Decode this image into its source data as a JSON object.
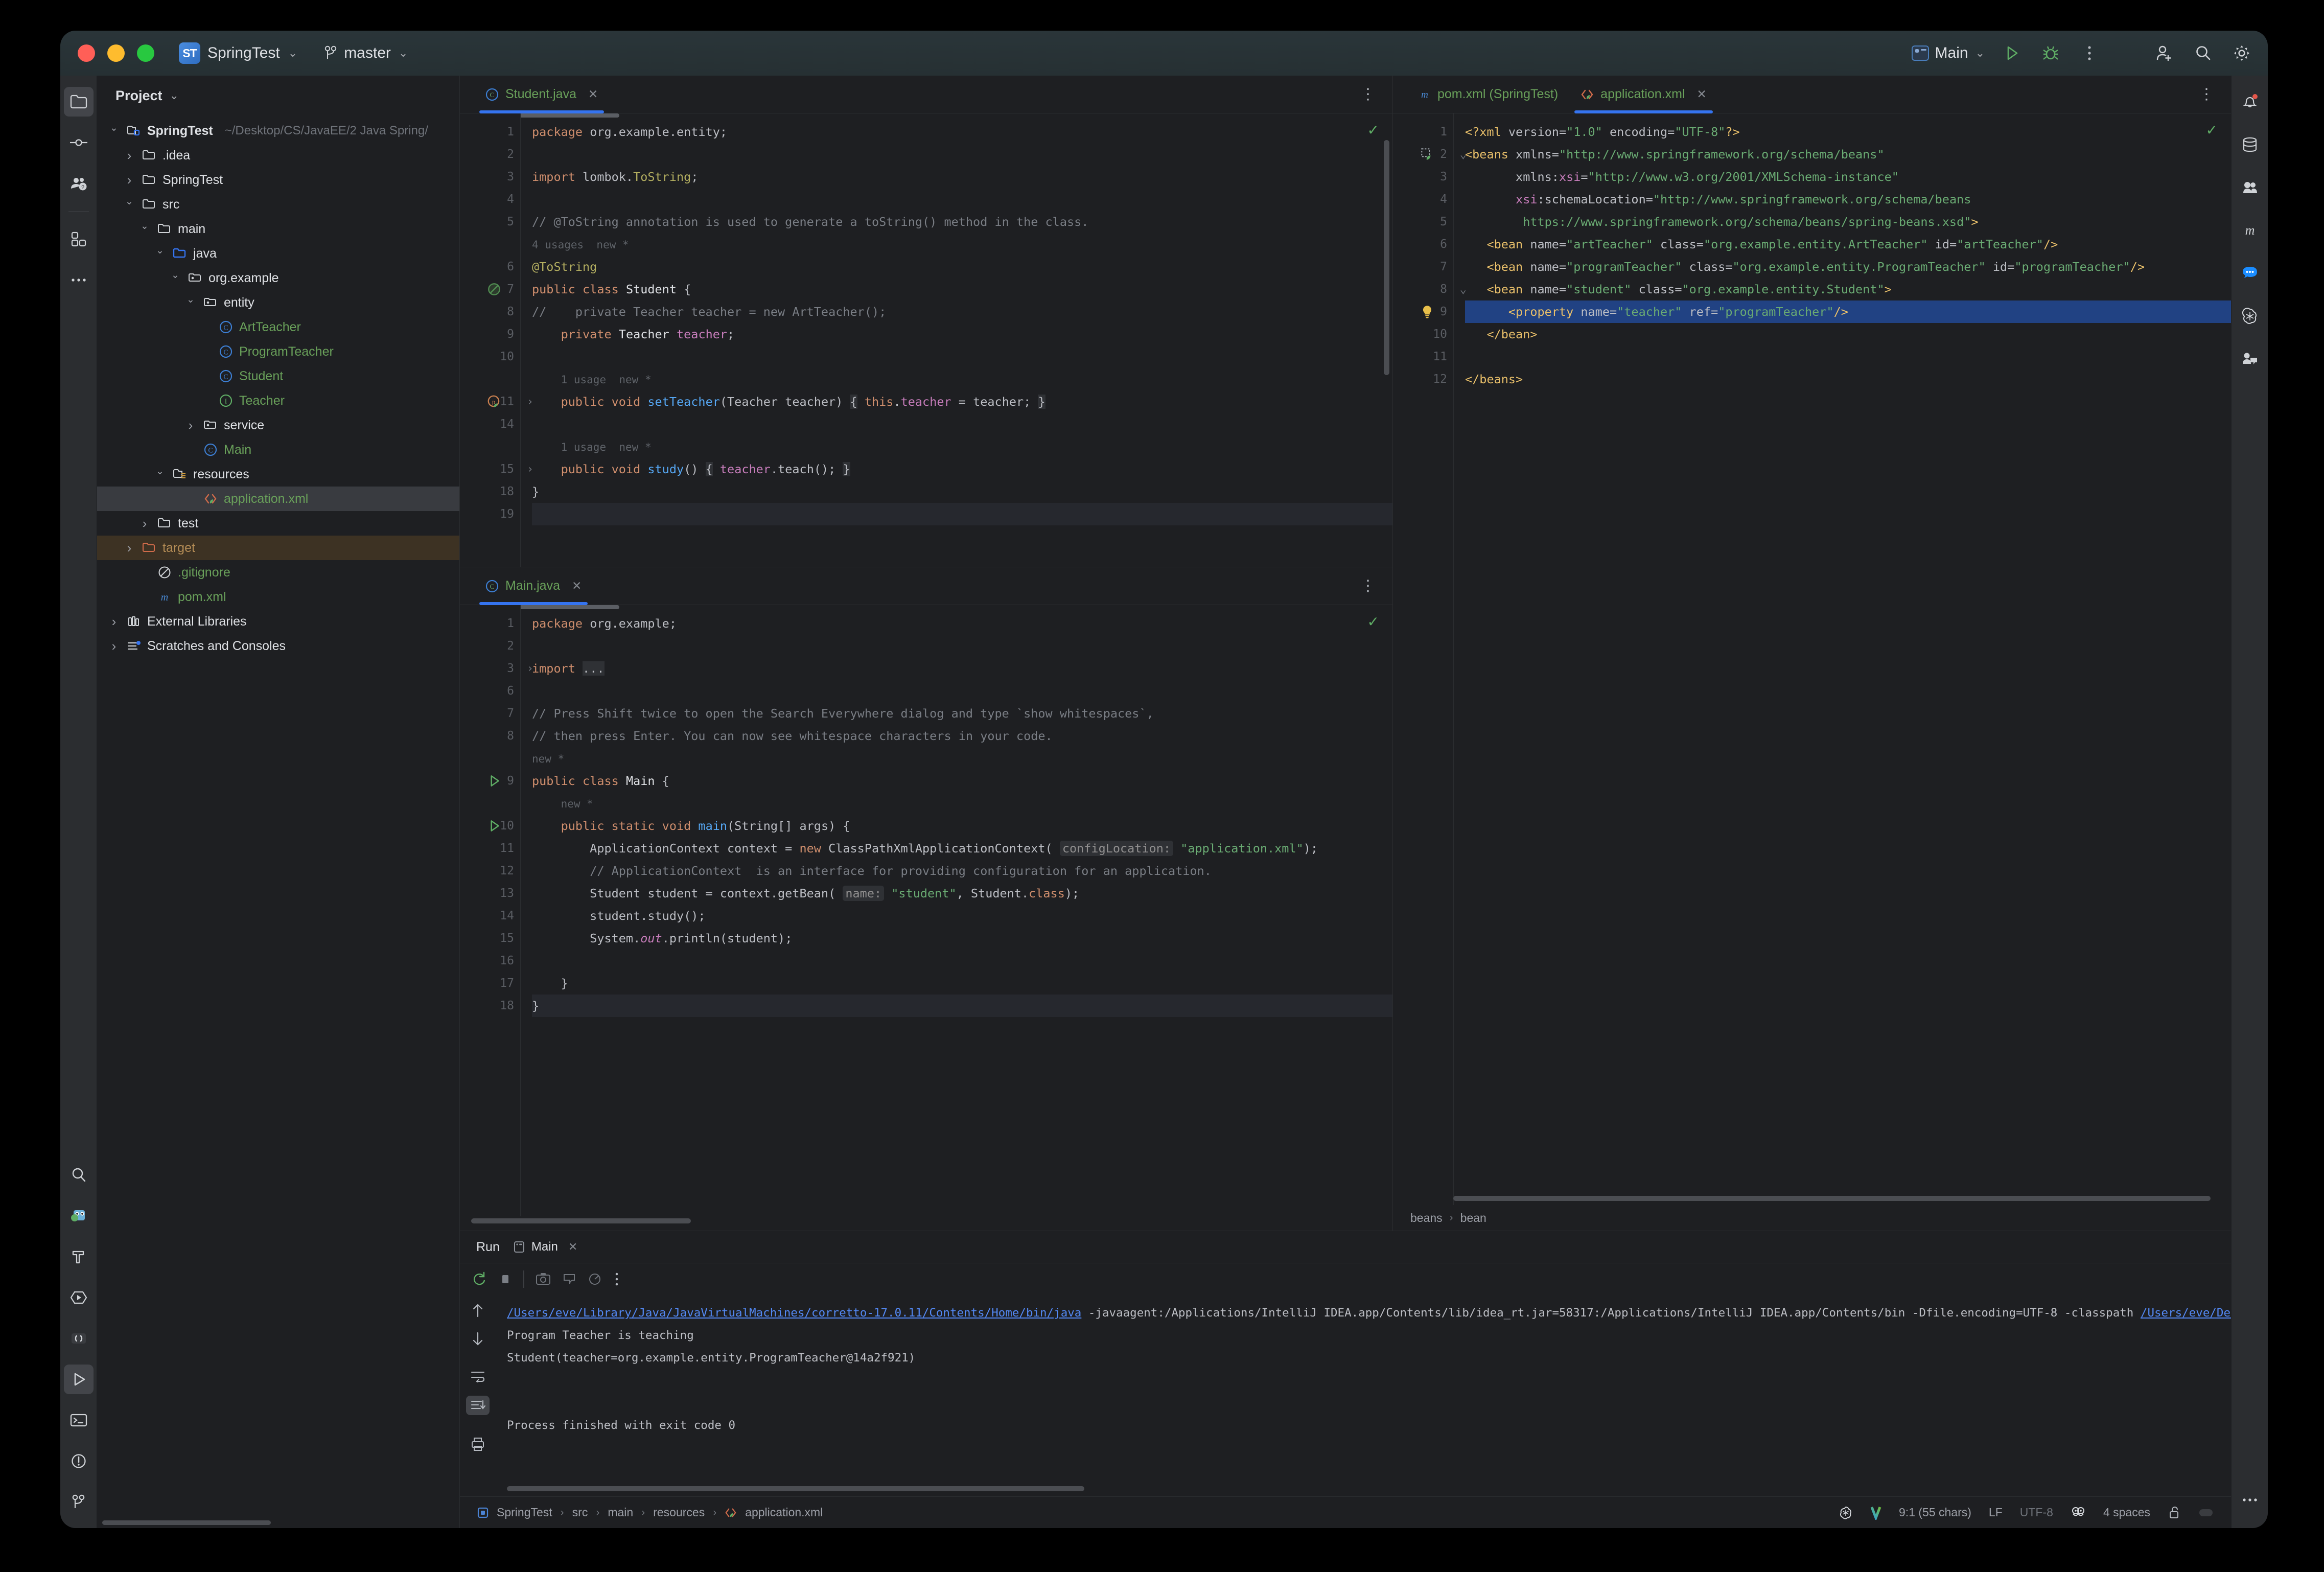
{
  "titlebar": {
    "project_badge": "ST",
    "project_name": "SpringTest",
    "branch": "master",
    "run_config": "Main",
    "icons": [
      "run-icon",
      "debug-icon",
      "more-options-icon",
      "add-user-icon",
      "search-icon",
      "settings-icon"
    ]
  },
  "project_panel": {
    "title": "Project",
    "tree": [
      {
        "label": "SpringTest",
        "path": "~/Desktop/CS/JavaEE/2 Java Spring/",
        "indent": 0,
        "arrow": "down",
        "icon": "module-folder-icon",
        "style": "bold"
      },
      {
        "label": ".idea",
        "indent": 1,
        "arrow": "right",
        "icon": "folder-icon",
        "style": "plain"
      },
      {
        "label": "SpringTest",
        "indent": 1,
        "arrow": "right",
        "icon": "folder-icon",
        "style": "plain"
      },
      {
        "label": "src",
        "indent": 1,
        "arrow": "down",
        "icon": "folder-icon",
        "style": "plain"
      },
      {
        "label": "main",
        "indent": 2,
        "arrow": "down",
        "icon": "folder-icon",
        "style": "plain"
      },
      {
        "label": "java",
        "indent": 3,
        "arrow": "down",
        "icon": "source-root-icon",
        "style": "plain"
      },
      {
        "label": "org.example",
        "indent": 4,
        "arrow": "down",
        "icon": "package-icon",
        "style": "plain"
      },
      {
        "label": "entity",
        "indent": 5,
        "arrow": "down",
        "icon": "package-icon",
        "style": "plain"
      },
      {
        "label": "ArtTeacher",
        "indent": 6,
        "arrow": "none",
        "icon": "java-class-icon",
        "style": "green"
      },
      {
        "label": "ProgramTeacher",
        "indent": 6,
        "arrow": "none",
        "icon": "java-class-icon",
        "style": "green"
      },
      {
        "label": "Student",
        "indent": 6,
        "arrow": "none",
        "icon": "java-class-icon",
        "style": "green"
      },
      {
        "label": "Teacher",
        "indent": 6,
        "arrow": "none",
        "icon": "java-interface-icon",
        "style": "green"
      },
      {
        "label": "service",
        "indent": 5,
        "arrow": "right",
        "icon": "package-icon",
        "style": "plain"
      },
      {
        "label": "Main",
        "indent": 5,
        "arrow": "none",
        "icon": "java-class-icon",
        "style": "green"
      },
      {
        "label": "resources",
        "indent": 3,
        "arrow": "down",
        "icon": "resource-root-icon",
        "style": "plain"
      },
      {
        "label": "application.xml",
        "indent": 5,
        "arrow": "none",
        "icon": "spring-xml-icon",
        "style": "green",
        "selected": true
      },
      {
        "label": "test",
        "indent": 2,
        "arrow": "right",
        "icon": "folder-icon",
        "style": "plain"
      },
      {
        "label": "target",
        "indent": 1,
        "arrow": "right",
        "icon": "excluded-folder-icon",
        "style": "gold",
        "highlight": true
      },
      {
        "label": ".gitignore",
        "indent": 2,
        "arrow": "none",
        "icon": "gitignore-icon",
        "style": "green"
      },
      {
        "label": "pom.xml",
        "indent": 2,
        "arrow": "none",
        "icon": "maven-icon",
        "style": "green"
      },
      {
        "label": "External Libraries",
        "indent": 0,
        "arrow": "right",
        "icon": "libraries-icon",
        "style": "plain"
      },
      {
        "label": "Scratches and Consoles",
        "indent": 0,
        "arrow": "right",
        "icon": "scratches-icon",
        "style": "plain"
      }
    ]
  },
  "editor_left_top": {
    "tabs": [
      {
        "label": "Student.java",
        "icon": "java-class-icon",
        "active": true,
        "closable": true
      }
    ],
    "lines": [
      {
        "n": "1",
        "html": "<span class=\"kw\">package</span> org.example.entity;"
      },
      {
        "n": "2",
        "html": ""
      },
      {
        "n": "3",
        "html": "<span class=\"kw\">import</span> lombok.<span class=\"ann\">ToString</span>;"
      },
      {
        "n": "4",
        "html": ""
      },
      {
        "n": "5",
        "html": "<span class=\"cmt\">// @ToString annotation is used to generate a toString() method in the class.</span>"
      },
      {
        "n": "",
        "html": "<span class=\"hint\">4 usages  new *</span>"
      },
      {
        "n": "6",
        "html": "<span class=\"ann\">@ToString</span>"
      },
      {
        "n": "7",
        "html": "<span class=\"kw\">public class</span> <span class=\"white\">Student</span> {",
        "gutter_icon": "spring-bean-disabled-icon"
      },
      {
        "n": "8",
        "html": "<span class=\"cmt\">//    private Teacher teacher = new ArtTeacher();</span>"
      },
      {
        "n": "9",
        "html": "    <span class=\"kw\">private</span> <span class=\"white\">Teacher</span> <span class=\"fld\">teacher</span>;"
      },
      {
        "n": "10",
        "html": ""
      },
      {
        "n": "",
        "html": "    <span class=\"hint\">1 usage  new *</span>"
      },
      {
        "n": "11",
        "html": "    <span class=\"kw\">public void</span> <span class=\"meth\">setTeacher</span>(Teacher teacher) <span class=\"brace\">{</span> <span class=\"kw\">this</span>.<span class=\"fld\">teacher</span> = teacher; <span class=\"brace\">}</span>",
        "gutter_icon": "spring-property-icon",
        "fold": true
      },
      {
        "n": "14",
        "html": ""
      },
      {
        "n": "",
        "html": "    <span class=\"hint\">1 usage  new *</span>"
      },
      {
        "n": "15",
        "html": "    <span class=\"kw\">public void</span> <span class=\"meth\">study</span>() <span class=\"brace\">{</span> <span class=\"fld\">teacher</span>.teach(); <span class=\"brace\">}</span>",
        "fold": true
      },
      {
        "n": "18",
        "html": "}"
      },
      {
        "n": "19",
        "html": "",
        "hl": true
      }
    ]
  },
  "editor_left_bottom": {
    "tabs": [
      {
        "label": "Main.java",
        "icon": "java-class-icon",
        "active": true,
        "closable": true
      }
    ],
    "lines": [
      {
        "n": "1",
        "html": "<span class=\"kw\">package</span> org.example;"
      },
      {
        "n": "2",
        "html": ""
      },
      {
        "n": "3",
        "html": "<span class=\"kw\">import</span> <span class=\"brace\">...</span>",
        "fold_open": true
      },
      {
        "n": "6",
        "html": ""
      },
      {
        "n": "7",
        "html": "<span class=\"cmt\">// Press Shift twice to open the Search Everywhere dialog and type `show whitespaces`,</span>"
      },
      {
        "n": "8",
        "html": "<span class=\"cmt\">// then press Enter. You can now see whitespace characters in your code.</span>"
      },
      {
        "n": "",
        "html": "<span class=\"hint\">new *</span>"
      },
      {
        "n": "9",
        "html": "<span class=\"kw\">public class</span> <span class=\"white\">Main</span> {",
        "gutter_icon": "run-gutter-icon"
      },
      {
        "n": "",
        "html": "    <span class=\"hint\">new *</span>"
      },
      {
        "n": "10",
        "html": "    <span class=\"kw\">public static void</span> <span class=\"meth\">main</span>(String[] args) {",
        "gutter_icon": "run-gutter-icon"
      },
      {
        "n": "11",
        "html": "        ApplicationContext context = <span class=\"kw\">new</span> ClassPathXmlApplicationContext( <span class=\"param\">configLocation:</span> <span class=\"str\">\"application.xml\"</span>);"
      },
      {
        "n": "12",
        "html": "        <span class=\"cmt\">// ApplicationContext  is an interface for providing configuration for an application.</span>"
      },
      {
        "n": "13",
        "html": "        Student student = context.getBean( <span class=\"param\">name:</span> <span class=\"str\">\"student\"</span>, Student.<span class=\"kw\">class</span>);"
      },
      {
        "n": "14",
        "html": "        student.study();"
      },
      {
        "n": "15",
        "html": "        System.<span class=\"fld\"><i>out</i></span>.println(student);"
      },
      {
        "n": "16",
        "html": ""
      },
      {
        "n": "17",
        "html": "    }"
      },
      {
        "n": "18",
        "html": "}",
        "hl": true
      }
    ]
  },
  "editor_right": {
    "tabs": [
      {
        "label": "pom.xml (SpringTest)",
        "icon": "maven-icon",
        "active": false,
        "closable": false
      },
      {
        "label": "application.xml",
        "icon": "spring-xml-icon",
        "active": true,
        "closable": true
      }
    ],
    "breadcrumb": [
      "beans",
      "bean"
    ],
    "lines": [
      {
        "n": "1",
        "html": "<span class=\"tag\">&lt;?xml</span> <span class=\"attr\">version=</span><span class=\"str\">\"1.0\"</span> <span class=\"attr\">encoding=</span><span class=\"str\">\"UTF-8\"</span><span class=\"tag\">?&gt;</span>"
      },
      {
        "n": "2",
        "html": "<span class=\"tag\">&lt;beans</span> <span class=\"attr\">xmlns=</span><span class=\"str\">\"http://www.springframework.org/schema/beans\"</span>",
        "gutter_icon": "spring-config-icon",
        "fold": "down"
      },
      {
        "n": "3",
        "html": "       <span class=\"attr\">xmlns:</span><span class=\"xsi\">xsi</span><span class=\"attr\">=</span><span class=\"str\">\"http://www.w3.org/2001/XMLSchema-instance\"</span>"
      },
      {
        "n": "4",
        "html": "       <span class=\"xsi\">xsi</span><span class=\"attr\">:schemaLocation=</span><span class=\"str\">\"http://www.springframework.org/schema/beans</span>"
      },
      {
        "n": "5",
        "html": "        <span class=\"str\">https://www.springframework.org/schema/beans/spring-beans.xsd\"</span><span class=\"tag\">&gt;</span>"
      },
      {
        "n": "6",
        "html": "   <span class=\"tag\">&lt;bean</span> <span class=\"attr\">name=</span><span class=\"str\">\"artTeacher\"</span> <span class=\"attr\">class=</span><span class=\"str\">\"org.example.entity.ArtTeacher\"</span> <span class=\"attr\">id=</span><span class=\"str\">\"artTeacher\"</span><span class=\"tag\">/&gt;</span>"
      },
      {
        "n": "7",
        "html": "   <span class=\"tag\">&lt;bean</span> <span class=\"attr\">name=</span><span class=\"str\">\"programTeacher\"</span> <span class=\"attr\">class=</span><span class=\"str\">\"org.example.entity.ProgramTeacher\"</span> <span class=\"attr\">id=</span><span class=\"str\">\"programTeacher\"</span><span class=\"tag\">/&gt;</span>"
      },
      {
        "n": "8",
        "html": "   <span class=\"tag\">&lt;bean</span> <span class=\"attr\">name=</span><span class=\"str\">\"student\"</span> <span class=\"attr\">class=</span><span class=\"str\">\"org.example.entity.Student\"</span><span class=\"tag\">&gt;</span>",
        "fold": "down"
      },
      {
        "n": "9",
        "html": "      <span class=\"tag\">&lt;property</span> <span class=\"attr\">name=</span><span class=\"str\">\"teacher\"</span> <span class=\"attr\">ref=</span><span class=\"str\">\"programTeacher\"</span><span class=\"tag\">/&gt;</span>",
        "gutter_icon": "intention-bulb-icon",
        "selected": true
      },
      {
        "n": "10",
        "html": "   <span class=\"tag\">&lt;/bean&gt;</span>"
      },
      {
        "n": "11",
        "html": ""
      },
      {
        "n": "12",
        "html": "<span class=\"tag\">&lt;/beans&gt;</span>"
      }
    ]
  },
  "run_panel": {
    "title": "Run",
    "tab": "Main",
    "toolbar_icons": [
      "rerun-icon",
      "stop-icon",
      "camera-icon",
      "thread-dump-icon",
      "coverage-icon",
      "more-icon"
    ],
    "side_icons": [
      "scroll-up-icon",
      "scroll-down-icon",
      "soft-wrap-icon",
      "scroll-to-end-icon",
      "print-icon"
    ],
    "console": [
      {
        "type": "cmd",
        "link1": "/Users/eve/Library/Java/JavaVirtualMachines/corretto-17.0.11/Contents/Home/bin/java",
        "mid": " -javaagent:/Applications/IntelliJ IDEA.app/Contents/lib/idea_rt.jar=58317:/Applications/IntelliJ IDEA.app/Contents/bin -Dfile.encoding=UTF-8 -classpath ",
        "link2": "/Users/eve/Desktop/CS/J"
      },
      {
        "type": "out",
        "text": "Program Teacher is teaching"
      },
      {
        "type": "out",
        "text": "Student(teacher=org.example.entity.ProgramTeacher@14a2f921)"
      },
      {
        "type": "out",
        "text": ""
      },
      {
        "type": "out",
        "text": ""
      },
      {
        "type": "out",
        "text": "Process finished with exit code 0"
      }
    ]
  },
  "statusbar": {
    "breadcrumb": [
      "SpringTest",
      "src",
      "main",
      "resources",
      "application.xml"
    ],
    "caret": "9:1 (55 chars)",
    "line_sep": "LF",
    "encoding": "UTF-8",
    "indent": "4 spaces",
    "right_icons": [
      "openai-icon",
      "version-icon",
      "inspections-icon",
      "lock-icon",
      "memory-icon"
    ]
  },
  "right_rail": {
    "icons": [
      "notifications-icon",
      "database-icon",
      "meetup-icon",
      "maven-icon",
      "chat-icon",
      "openai-icon",
      "code-with-me-icon",
      "more-icon"
    ]
  },
  "left_rail": {
    "top_icons": [
      "project-icon",
      "commit-icon",
      "pull-requests-icon",
      "plugins-icon",
      "more-icon"
    ],
    "bottom_icons": [
      "search-icon",
      "spring-icon",
      "build-icon",
      "services-icon",
      "structure-icon",
      "run-icon",
      "terminal-icon",
      "problems-icon",
      "git-icon"
    ]
  },
  "colors": {
    "accent": "#3574f0",
    "selection": "#214283",
    "string": "#6aab73",
    "keyword": "#cf8e6d",
    "comment": "#7a7e85",
    "tag": "#e8bf6a",
    "bg": "#1e1f22",
    "panel": "#2b2d30"
  }
}
